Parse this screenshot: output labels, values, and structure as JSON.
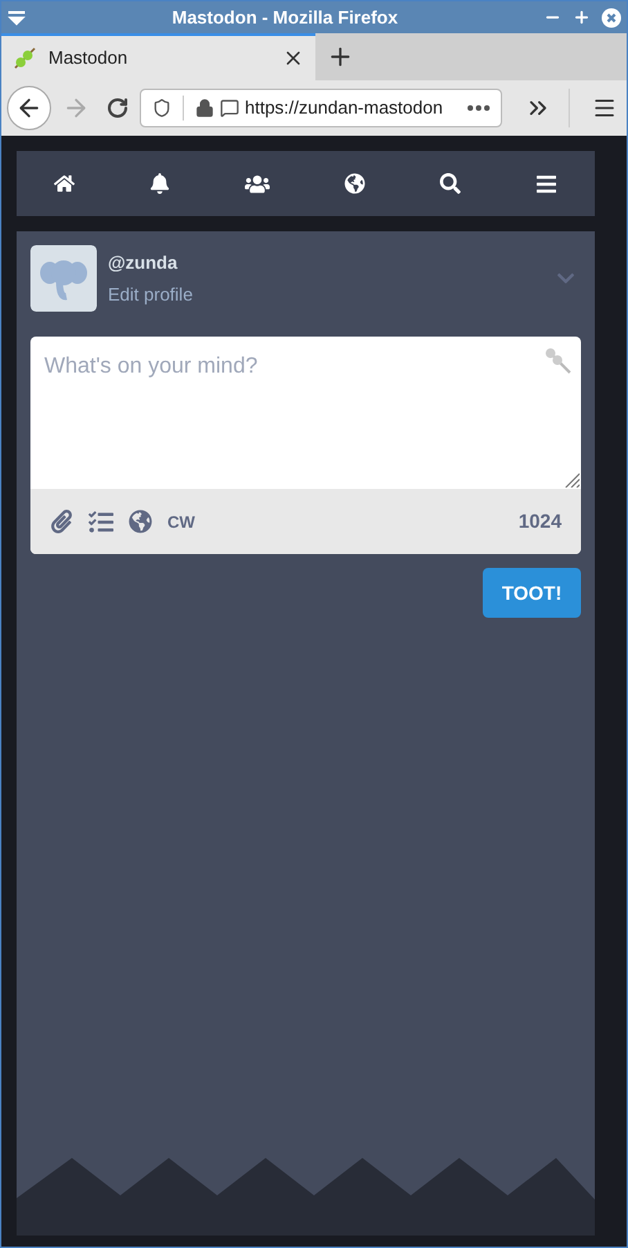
{
  "window": {
    "title": "Mastodon - Mozilla Firefox"
  },
  "tabs": [
    {
      "label": "Mastodon",
      "selected": true
    }
  ],
  "address_bar": {
    "url": "https://zundan-mastodon"
  },
  "profile": {
    "handle": "@zunda",
    "edit_link": "Edit profile"
  },
  "compose": {
    "placeholder": "What's on your mind?",
    "cw_label": "CW",
    "character_count": "1024",
    "submit": "TOOT!"
  }
}
